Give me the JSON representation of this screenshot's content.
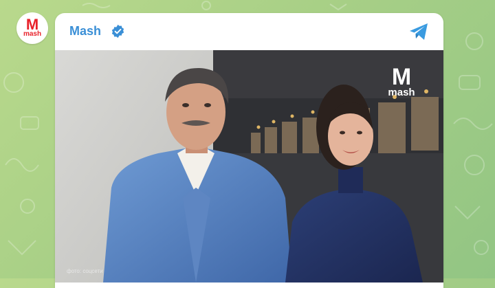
{
  "channel": {
    "name": "Mash",
    "verified": true,
    "avatar_text": "M",
    "avatar_subtext": "mash"
  },
  "post": {
    "photo_credit": "фото: соцсети",
    "watermark_main": "M",
    "watermark_sub": "mash"
  },
  "icons": {
    "verified": "verified-badge-icon",
    "share": "telegram-plane-icon"
  },
  "colors": {
    "background_green": "#a7cf86",
    "channel_blue": "#3a8fd6",
    "brand_red": "#e8212a",
    "telegram_blue": "#3a9be0"
  }
}
